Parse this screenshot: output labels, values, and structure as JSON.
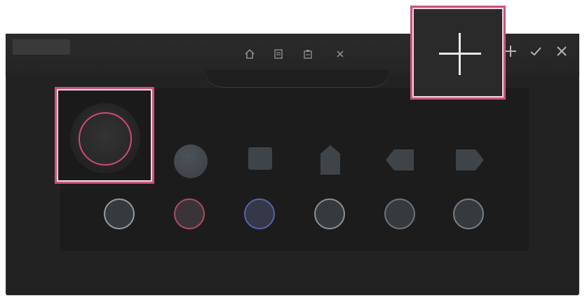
{
  "colors": {
    "window_bg": "#222222",
    "panel_bg": "#1c1c1c",
    "highlight": "#c8547e",
    "accent_red": "#d24b6e",
    "accent_blue": "#5a63a8",
    "accent_gray": "#9a9a9a",
    "accent_green_gray": "#7f8a80"
  },
  "toolbar": {
    "icons": [
      "home-icon",
      "document-icon",
      "clipboard-icon",
      "close-icon"
    ]
  },
  "window_controls": {
    "icons": [
      "plus-icon",
      "check-icon",
      "close-icon"
    ]
  },
  "shape_palette": {
    "selected": "circle-shape",
    "shapes": [
      "circle",
      "square",
      "pentagon",
      "arrow-left",
      "arrow-right"
    ]
  },
  "color_swatches": [
    {
      "name": "swatch-gray",
      "ring_color": "#9a9a9a"
    },
    {
      "name": "swatch-red",
      "ring_color": "#b04b60"
    },
    {
      "name": "swatch-blue",
      "ring_color": "#5a63a8"
    },
    {
      "name": "swatch-gray-2",
      "ring_color": "#8f8f8f"
    },
    {
      "name": "swatch-dark",
      "ring_color": "#6f7478"
    },
    {
      "name": "swatch-dark-2",
      "ring_color": "#7a7f84"
    }
  ],
  "highlight_targets": [
    "selected-shape",
    "add-button"
  ]
}
